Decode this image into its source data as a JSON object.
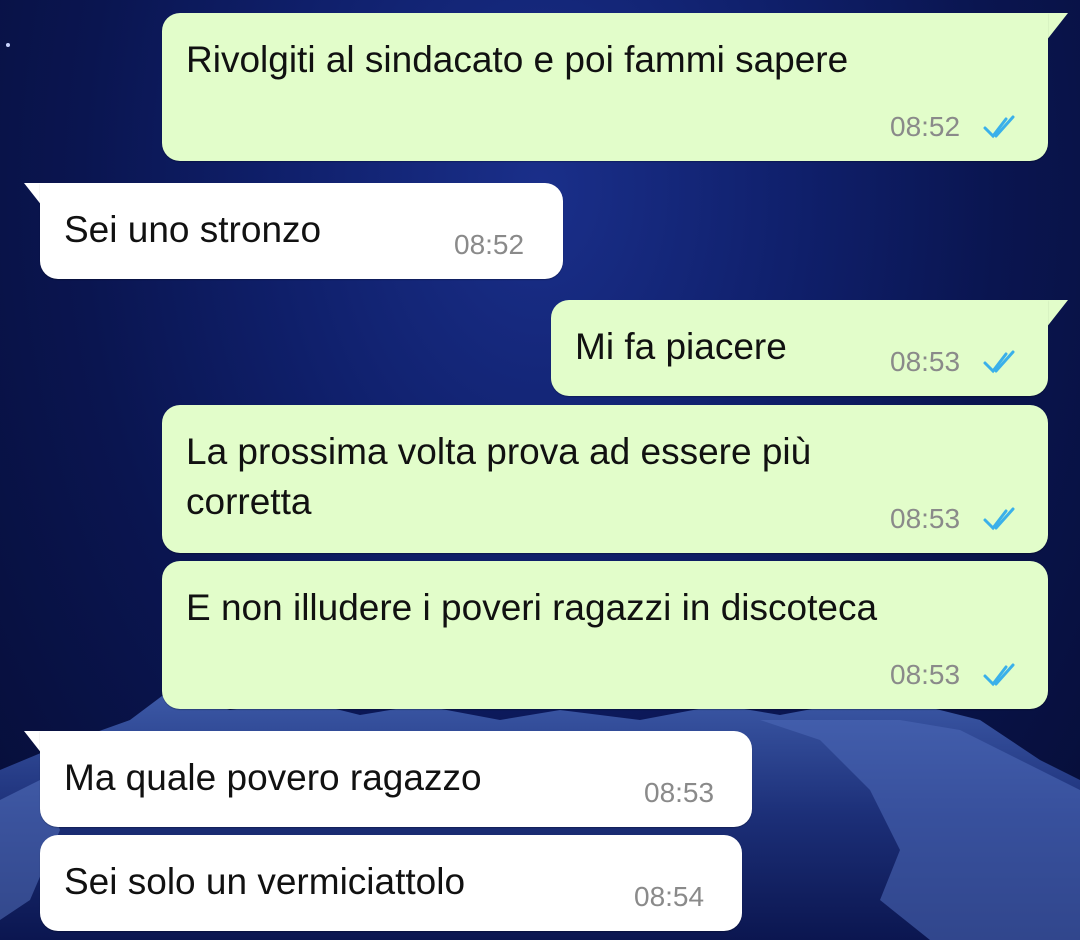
{
  "theme": {
    "outgoing_bubble": "#e2fdca",
    "incoming_bubble": "#ffffff",
    "read_tick_color": "#3ab0ea",
    "wallpaper": "dark blue night sky with snowy mountains"
  },
  "messages": [
    {
      "direction": "outgoing",
      "text": "Rivolgiti al sindacato e poi fammi sapere",
      "time": "08:52",
      "status": "read-double-check-icon"
    },
    {
      "direction": "incoming",
      "text": "Sei uno stronzo",
      "time": "08:52"
    },
    {
      "direction": "outgoing",
      "text": "Mi fa piacere",
      "time": "08:53",
      "status": "read-double-check-icon"
    },
    {
      "direction": "outgoing",
      "text_line1": "La prossima volta prova ad essere più",
      "text_line2": "corretta",
      "time": "08:53",
      "status": "read-double-check-icon"
    },
    {
      "direction": "outgoing",
      "text": "E non illudere i poveri ragazzi in discoteca",
      "time": "08:53",
      "status": "read-double-check-icon"
    },
    {
      "direction": "incoming",
      "text": "Ma quale povero ragazzo",
      "time": "08:53"
    },
    {
      "direction": "incoming",
      "text": "Sei solo un vermiciattolo",
      "time": "08:54"
    }
  ]
}
